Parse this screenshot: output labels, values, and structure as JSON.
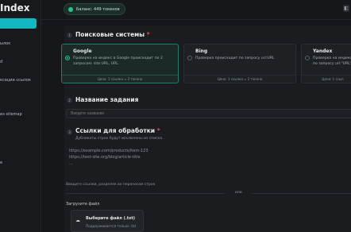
{
  "sidebar": {
    "brand": "Index",
    "items": [
      {
        "label": ""
      },
      {
        "label": "ылок"
      },
      {
        "label": "d"
      },
      {
        "label": "ксации ссылок"
      },
      {
        "label": "из sitemap"
      },
      {
        "label": "e"
      }
    ]
  },
  "header": {
    "balance": "Баланс: 449 токенов",
    "balance_icon": "token-icon",
    "corner_icon": "user-icon"
  },
  "sections": {
    "search_engines": {
      "number": "1",
      "title": "Поисковые системы",
      "required_mark": "*",
      "engines": [
        {
          "name": "Google",
          "desc": "Проверка на индекс в Google происходит по 2 запросам: site:URL, URL",
          "price": "Цена: 1 ссылка = 2 токена",
          "selected": true
        },
        {
          "name": "Bing",
          "desc": "Проверка происходит по запросу url:URL",
          "price": "Цена: 1 ссылка = 2 токена",
          "selected": false
        },
        {
          "name": "Yandex",
          "desc": "Проверка на индекс в Я по запросу url:\"URL\"",
          "price": "Цена: 1 ссыл",
          "selected": false
        }
      ]
    },
    "task_name": {
      "number": "2",
      "title": "Название задания",
      "placeholder": "Введите название"
    },
    "links": {
      "number": "3",
      "title": "Ссылки для обработки",
      "required_mark": "*",
      "subtitle": "Дубликаты строк будут исключены из списка.",
      "placeholder_lines": [
        "https://example.com/products/item-123",
        "https://test-site.org/blog/article-title",
        "..."
      ],
      "hint": "Введите ссылки, разделяя их переносом строк",
      "or": "или",
      "upload_label": "Загрузите файл",
      "upload_button": "Выберите файл (.txt)",
      "upload_sub": "Поддерживается только .txt"
    }
  }
}
